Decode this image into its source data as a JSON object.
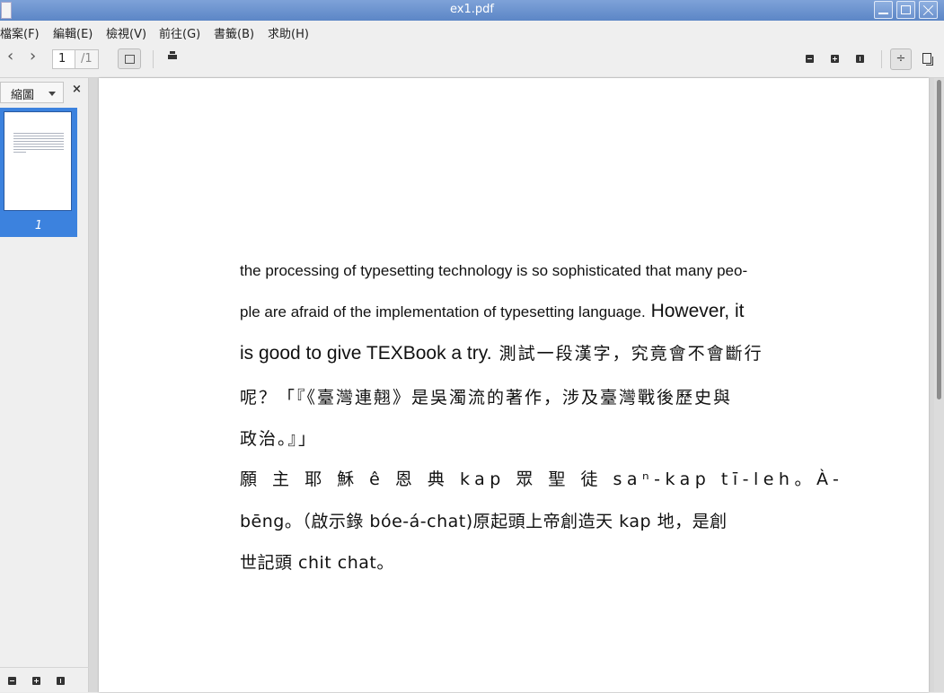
{
  "window": {
    "title": "ex1.pdf"
  },
  "menu": [
    "檔案(F)",
    "編輯(E)",
    "檢視(V)",
    "前往(G)",
    "書籤(B)",
    "求助(H)"
  ],
  "toolbar": {
    "back_glyph": "‹",
    "forward_glyph": "›",
    "page_current": "1",
    "page_total": "/1",
    "fit_width_glyph": "÷"
  },
  "sidebar": {
    "view_label": "縮圖",
    "close_glyph": "×",
    "thumbnail_page_label": "1"
  },
  "document": {
    "line1": "the processing of typesetting technology is so sophisticated that many peo-",
    "line2_a": "ple are afraid of the implementation of typesetting language.",
    "line2_b": " However, it",
    "line3_a": "is good to give TEXBook a try.",
    "line3_b": " 測試一段漢字，究竟會不會斷行",
    "line4": "呢？「『《臺灣連翹》是吳濁流的著作，涉及臺灣戰後歷史與",
    "line5": "政治。』」",
    "line6": "願 主 耶 穌 ê 恩 典 kap 眾 聖 徒 saⁿ-kap tī-leh。À-",
    "line7": "bēng。（啟示錄 bóe-á-chat)原起頭上帝創造天 kap 地，是創",
    "line8": "世記頭 chit chat。"
  },
  "icons": {
    "print": "printer-icon",
    "zoom_out": "zoom-out-icon",
    "zoom_in": "zoom-in-icon",
    "original_size": "original-size-icon",
    "dual_page": "dual-page-icon",
    "sidebar_toggle": "sidebar-toggle-icon"
  },
  "colors": {
    "titlebar": "#6b93cf",
    "thumbnail_selected": "#3c82de"
  }
}
